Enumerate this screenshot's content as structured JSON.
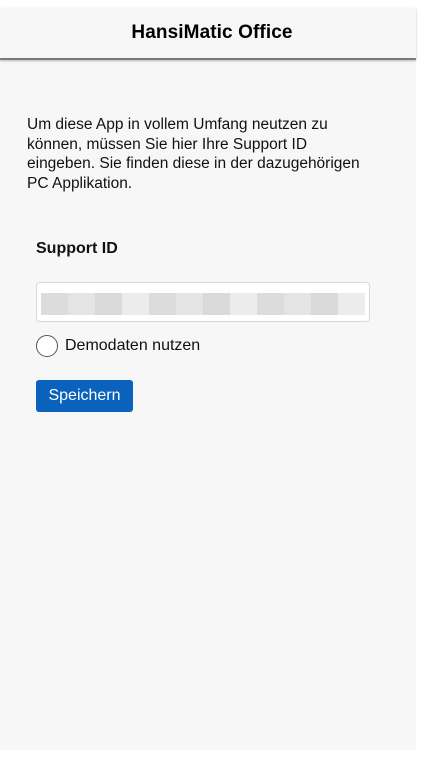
{
  "header": {
    "title": "HansiMatic Office"
  },
  "intro": {
    "text": "Um diese App in vollem Umfang neutzen zu können, müssen Sie hier Ihre Support ID eingeben. Sie finden diese in der dazugehörigen PC Applikation."
  },
  "support": {
    "label": "Support ID",
    "value_redacted": true
  },
  "demo": {
    "label": "Demodaten nutzen",
    "checked": false
  },
  "actions": {
    "save_label": "Speichern"
  },
  "colors": {
    "primary_button": "#0a62bd",
    "background": "#f7f7f7"
  }
}
